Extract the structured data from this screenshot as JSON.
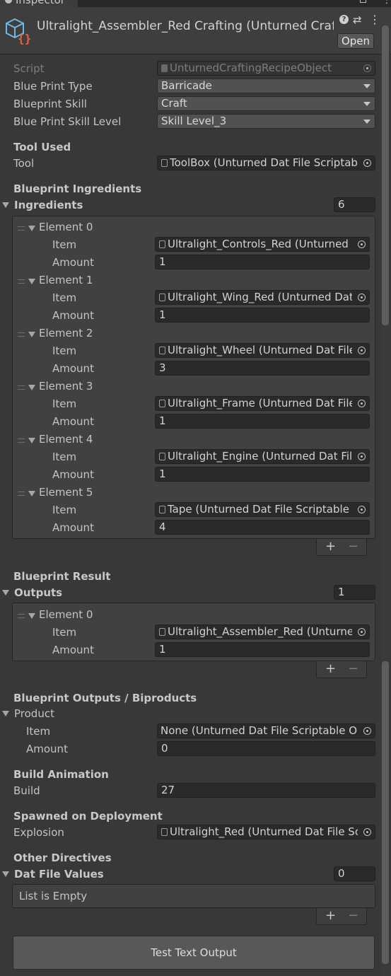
{
  "tab": {
    "label": "Inspector"
  },
  "header": {
    "title": "Ultralight_Assembler_Red Crafting (Unturned Crafting",
    "open_label": "Open"
  },
  "fields": {
    "script": {
      "label": "Script",
      "value": "UnturnedCraftingRecipeObject"
    },
    "blue_print_type": {
      "label": "Blue Print Type",
      "value": "Barricade"
    },
    "blueprint_skill": {
      "label": "Blueprint Skill",
      "value": "Craft"
    },
    "blue_print_skill_level": {
      "label": "Blue Print Skill Level",
      "value": "Skill Level_3"
    }
  },
  "tool_section": {
    "header": "Tool Used",
    "label": "Tool",
    "value": "ToolBox (Unturned Dat File Scriptable"
  },
  "ingredients": {
    "header": "Blueprint Ingredients",
    "label": "Ingredients",
    "count": "6",
    "item_label": "Item",
    "amount_label": "Amount",
    "elements": [
      {
        "name": "Element 0",
        "item": "Ultralight_Controls_Red (Unturned Da",
        "amount": "1"
      },
      {
        "name": "Element 1",
        "item": "Ultralight_Wing_Red (Unturned Dat Fi",
        "amount": "1"
      },
      {
        "name": "Element 2",
        "item": "Ultralight_Wheel (Unturned Dat File S",
        "amount": "3"
      },
      {
        "name": "Element 3",
        "item": "Ultralight_Frame (Unturned Dat File S",
        "amount": "1"
      },
      {
        "name": "Element 4",
        "item": "Ultralight_Engine (Unturned Dat File S",
        "amount": "1"
      },
      {
        "name": "Element 5",
        "item": "Tape (Unturned Dat File Scriptable O",
        "amount": "4"
      }
    ]
  },
  "outputs": {
    "header": "Blueprint Result",
    "label": "Outputs",
    "count": "1",
    "item_label": "Item",
    "amount_label": "Amount",
    "elements": [
      {
        "name": "Element 0",
        "item": "Ultralight_Assembler_Red (Unturned",
        "amount": "1"
      }
    ]
  },
  "product": {
    "header": "Blueprint Outputs / Biproducts",
    "label": "Product",
    "item_label": "Item",
    "item_value": "None (Unturned Dat File Scriptable Obje",
    "amount_label": "Amount",
    "amount_value": "0"
  },
  "build": {
    "header": "Build Animation",
    "label": "Build",
    "value": "27"
  },
  "spawn": {
    "header": "Spawned on Deployment",
    "label": "Explosion",
    "value": "Ultralight_Red (Unturned Dat File Scri"
  },
  "dat_values": {
    "header": "Other Directives",
    "label": "Dat File Values",
    "count": "0",
    "empty_text": "List is Empty"
  },
  "list_controls": {
    "plus": "+",
    "minus": "−"
  },
  "test_button": {
    "label": "Test Text Output"
  }
}
